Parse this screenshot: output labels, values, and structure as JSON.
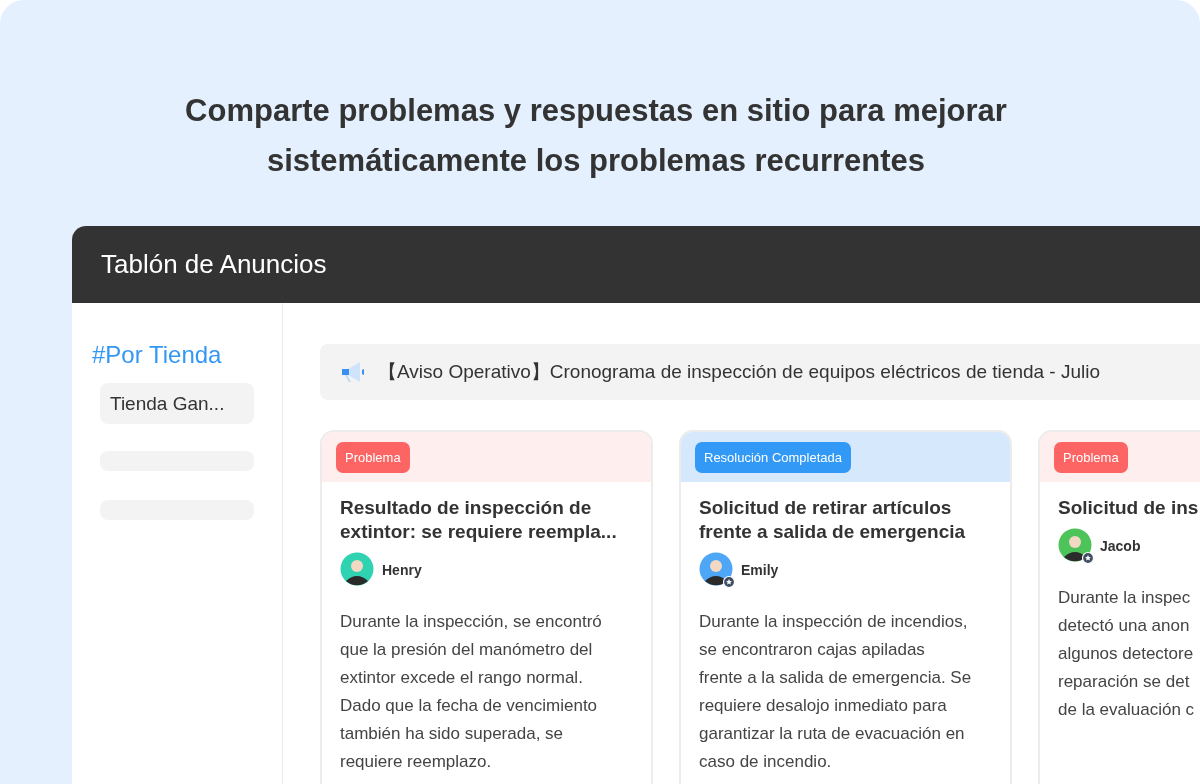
{
  "headline": [
    "Comparte problemas y respuestas en sitio para mejorar",
    "sistemáticamente los problemas recurrentes"
  ],
  "window": {
    "title": "Tablón de Anuncios"
  },
  "sidebar": {
    "title": "#Por Tienda",
    "items": [
      {
        "label": "Tienda Gan...",
        "selected": true
      }
    ]
  },
  "notice": {
    "text": "【Aviso Operativo】Cronograma de inspección de equipos eléctricos de tienda - Julio"
  },
  "cards": [
    {
      "tag": {
        "label": "Problema",
        "kind": "problem"
      },
      "title_lines": [
        "Resultado de inspección de",
        "extintor: se requiere reempla..."
      ],
      "author": {
        "name": "Henry",
        "color": "#2fd3b1",
        "badge": false
      },
      "body_lines": [
        "Durante la inspección, se encontró",
        "que la presión del manómetro del",
        "extintor excede el rango normal.",
        "Dado que la fecha de vencimiento",
        "también ha sido superada, se",
        "requiere reemplazo."
      ]
    },
    {
      "tag": {
        "label": "Resolución Completada",
        "kind": "resolved"
      },
      "title_lines": [
        "Solicitud de retirar artículos",
        "frente a salida de emergencia"
      ],
      "author": {
        "name": "Emily",
        "color": "#4ea6f6",
        "badge": true
      },
      "body_lines": [
        "Durante la inspección de incendios,",
        "se encontraron cajas apiladas",
        "frente a la salida de emergencia. Se",
        "requiere desalojo inmediato para",
        "garantizar la ruta de evacuación en",
        "caso de incendio."
      ]
    },
    {
      "tag": {
        "label": "Problema",
        "kind": "problem"
      },
      "title_lines": [
        "Solicitud de ins"
      ],
      "author": {
        "name": "Jacob",
        "color": "#4cc45a",
        "badge": true
      },
      "body_lines": [
        "Durante la inspec",
        "detectó una anon",
        "algunos detectore",
        "reparación se det",
        "de la evaluación c"
      ]
    }
  ]
}
